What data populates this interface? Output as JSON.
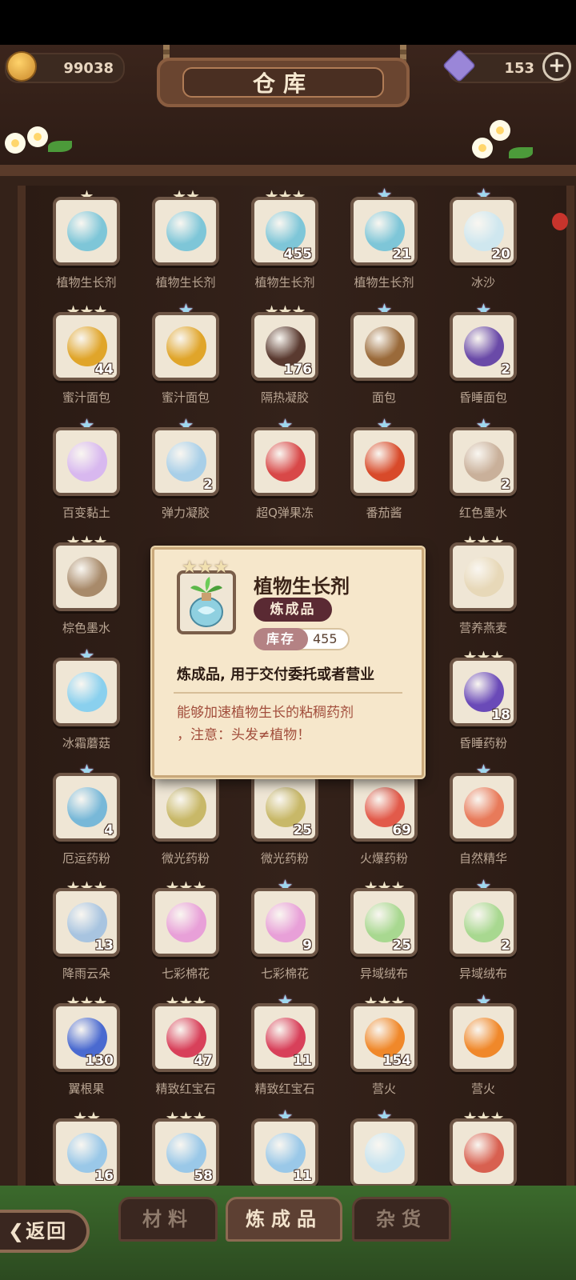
{
  "header": {
    "title": "仓库",
    "coins": "99038",
    "gems": "153",
    "plus_label": "+"
  },
  "rows": [
    [
      {
        "label": "植物生长剂",
        "stars": 1,
        "rainbow": false,
        "count": "",
        "art": "plant-vial"
      },
      {
        "label": "植物生长剂",
        "stars": 2,
        "rainbow": false,
        "count": "",
        "art": "plant-vial"
      },
      {
        "label": "植物生长剂",
        "stars": 3,
        "rainbow": false,
        "count": "455",
        "art": "plant-vial"
      },
      {
        "label": "植物生长剂",
        "stars": 1,
        "rainbow": true,
        "count": "21",
        "art": "plant-vial"
      },
      {
        "label": "冰沙",
        "stars": 1,
        "rainbow": true,
        "count": "20",
        "art": "shaved-ice"
      }
    ],
    [
      {
        "label": "蜜汁面包",
        "stars": 3,
        "rainbow": false,
        "count": "44",
        "art": "honey-bread"
      },
      {
        "label": "蜜汁面包",
        "stars": 1,
        "rainbow": true,
        "count": "",
        "art": "honey-bread"
      },
      {
        "label": "隔热凝胶",
        "stars": 3,
        "rainbow": false,
        "count": "176",
        "art": "gel-cube"
      },
      {
        "label": "面包",
        "stars": 1,
        "rainbow": true,
        "count": "",
        "art": "bread"
      },
      {
        "label": "昏睡面包",
        "stars": 1,
        "rainbow": true,
        "count": "2",
        "art": "sleep-bread"
      }
    ],
    [
      {
        "label": "百变黏土",
        "stars": 1,
        "rainbow": true,
        "count": "",
        "art": "clay-bear"
      },
      {
        "label": "弹力凝胶",
        "stars": 1,
        "rainbow": true,
        "count": "2",
        "art": "elastic-gel"
      },
      {
        "label": "超Q弹果冻",
        "stars": 1,
        "rainbow": true,
        "count": "",
        "art": "jelly"
      },
      {
        "label": "番茄酱",
        "stars": 1,
        "rainbow": true,
        "count": "",
        "art": "ketchup"
      },
      {
        "label": "红色墨水",
        "stars": 1,
        "rainbow": true,
        "count": "2",
        "art": "red-ink"
      }
    ],
    [
      {
        "label": "棕色墨水",
        "stars": 3,
        "rainbow": false,
        "count": "",
        "art": "brown-ink"
      },
      null,
      null,
      null,
      {
        "label": "营养燕麦",
        "stars": 3,
        "rainbow": false,
        "count": "",
        "art": "oatmeal"
      }
    ],
    [
      {
        "label": "冰霜蘑菇",
        "stars": 1,
        "rainbow": true,
        "count": "",
        "art": "frost-mushroom"
      },
      null,
      null,
      null,
      {
        "label": "昏睡药粉",
        "stars": 3,
        "rainbow": false,
        "count": "18",
        "art": "sleep-potion"
      }
    ],
    [
      {
        "label": "厄运药粉",
        "stars": 1,
        "rainbow": true,
        "count": "4",
        "art": "doom-powder"
      },
      {
        "label": "微光药粉",
        "stars": 3,
        "rainbow": false,
        "count": "",
        "art": "glow-bowl"
      },
      {
        "label": "微光药粉",
        "stars": 1,
        "rainbow": true,
        "count": "25",
        "art": "glow-bowl"
      },
      {
        "label": "火爆药粉",
        "stars": 3,
        "rainbow": false,
        "count": "69",
        "art": "fire-potion"
      },
      {
        "label": "自然精华",
        "stars": 1,
        "rainbow": true,
        "count": "",
        "art": "nature-essence"
      }
    ],
    [
      {
        "label": "降雨云朵",
        "stars": 3,
        "rainbow": false,
        "count": "13",
        "art": "rain-cloud"
      },
      {
        "label": "七彩棉花",
        "stars": 3,
        "rainbow": false,
        "count": "",
        "art": "rainbow-cotton"
      },
      {
        "label": "七彩棉花",
        "stars": 1,
        "rainbow": true,
        "count": "9",
        "art": "rainbow-cotton"
      },
      {
        "label": "异域绒布",
        "stars": 3,
        "rainbow": false,
        "count": "25",
        "art": "exotic-cloth"
      },
      {
        "label": "异域绒布",
        "stars": 1,
        "rainbow": true,
        "count": "2",
        "art": "exotic-cloth"
      }
    ],
    [
      {
        "label": "翼根果",
        "stars": 3,
        "rainbow": false,
        "count": "130",
        "art": "wing-berry"
      },
      {
        "label": "精致红宝石",
        "stars": 3,
        "rainbow": false,
        "count": "47",
        "art": "ruby"
      },
      {
        "label": "精致红宝石",
        "stars": 1,
        "rainbow": true,
        "count": "11",
        "art": "ruby"
      },
      {
        "label": "营火",
        "stars": 3,
        "rainbow": false,
        "count": "154",
        "art": "campfire"
      },
      {
        "label": "营火",
        "stars": 1,
        "rainbow": true,
        "count": "",
        "art": "campfire"
      }
    ],
    [
      {
        "label": "",
        "stars": 2,
        "rainbow": false,
        "count": "16",
        "art": "snowflakes"
      },
      {
        "label": "",
        "stars": 3,
        "rainbow": false,
        "count": "58",
        "art": "snowflakes"
      },
      {
        "label": "",
        "stars": 1,
        "rainbow": true,
        "count": "11",
        "art": "snowflakes"
      },
      {
        "label": "",
        "stars": 1,
        "rainbow": true,
        "count": "",
        "art": "ice-chunk"
      },
      {
        "label": "",
        "stars": 3,
        "rainbow": false,
        "count": "",
        "art": "red-bowl"
      }
    ]
  ],
  "popup": {
    "name": "植物生长剂",
    "category": "炼成品",
    "stock_label": "库存",
    "stock_value": "455",
    "stars": 3,
    "use": "炼成品, 用于交付委托或者营业",
    "desc_line1": "能够加速植物生长的粘稠药剂",
    "desc_line2": "，注意：头发≠植物！",
    "icon": "plant-vial"
  },
  "tabs": [
    {
      "label": "材料",
      "active": false
    },
    {
      "label": "炼成品",
      "active": true
    },
    {
      "label": "杂货",
      "active": false
    }
  ],
  "back_label": "返回",
  "colors": {
    "art": {
      "plant-vial": "#7ec6d8",
      "shaved-ice": "#cfe7ef",
      "honey-bread": "#e0a52a",
      "gel-cube": "#5a3a30",
      "bread": "#9a6a3a",
      "sleep-bread": "#6a4aa8",
      "clay-bear": "#d8b8ef",
      "elastic-gel": "#a8cfe8",
      "jelly": "#d84848",
      "ketchup": "#d84a2a",
      "red-ink": "#c9b09a",
      "brown-ink": "#a88a6a",
      "oatmeal": "#e7d8b8",
      "frost-mushroom": "#8ad0ee",
      "sleep-potion": "#6a4ab8",
      "doom-powder": "#78b8d8",
      "glow-bowl": "#c8b868",
      "fire-potion": "#e25a4a",
      "nature-essence": "#e87a5a",
      "rain-cloud": "#a8c4e0",
      "rainbow-cotton": "#e8a0d8",
      "exotic-cloth": "#a8d890",
      "wing-berry": "#4a6ad0",
      "ruby": "#d8405a",
      "campfire": "#f0882a",
      "snowflakes": "#9ac8e8",
      "ice-chunk": "#c8e4f0",
      "red-bowl": "#d86050"
    }
  }
}
